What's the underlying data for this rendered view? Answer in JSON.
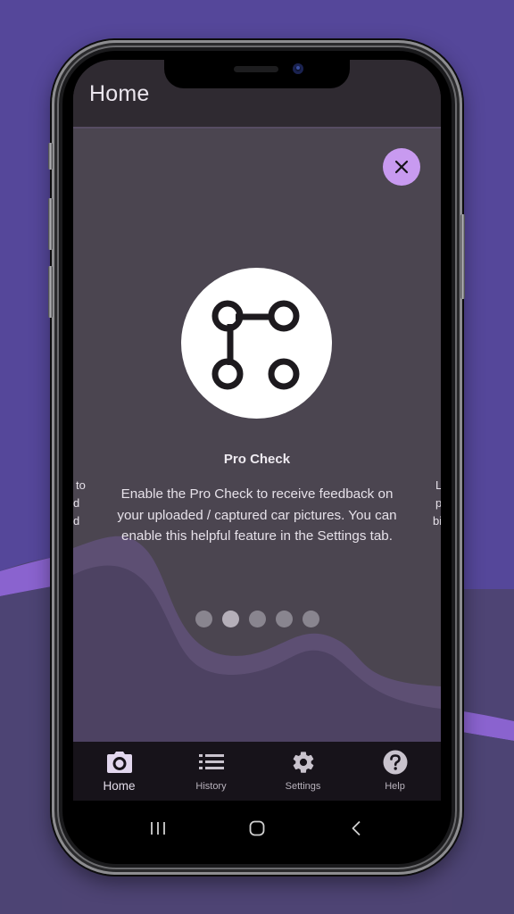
{
  "app": {
    "title": "Home"
  },
  "onboarding": {
    "close_icon": "close-icon",
    "feature_icon": "pattern-lock-icon",
    "title": "Pro Check",
    "body": "Enable the Pro Check to receive feedback on your uploaded / captured car pictures. You can enable this helpful feature in the Settings tab.",
    "peek_left_lines": [
      "to",
      "d",
      "d"
    ],
    "peek_right_lines": [
      "L",
      "p",
      "bi"
    ],
    "pager": {
      "total": 5,
      "current_index": 2
    }
  },
  "bottom_nav": {
    "items": [
      {
        "label": "Home",
        "icon": "camera-icon",
        "active": true
      },
      {
        "label": "History",
        "icon": "list-icon",
        "active": false
      },
      {
        "label": "Settings",
        "icon": "gear-icon",
        "active": false
      },
      {
        "label": "Help",
        "icon": "help-icon",
        "active": false
      }
    ]
  },
  "system_nav": {
    "recents": "recents-icon",
    "home": "home-icon",
    "back": "back-icon"
  },
  "colors": {
    "accent": "#c89af0",
    "background": "#55479a",
    "surface": "#4b4550",
    "appbar": "#2f2a31",
    "nav_bar": "#17131a"
  }
}
